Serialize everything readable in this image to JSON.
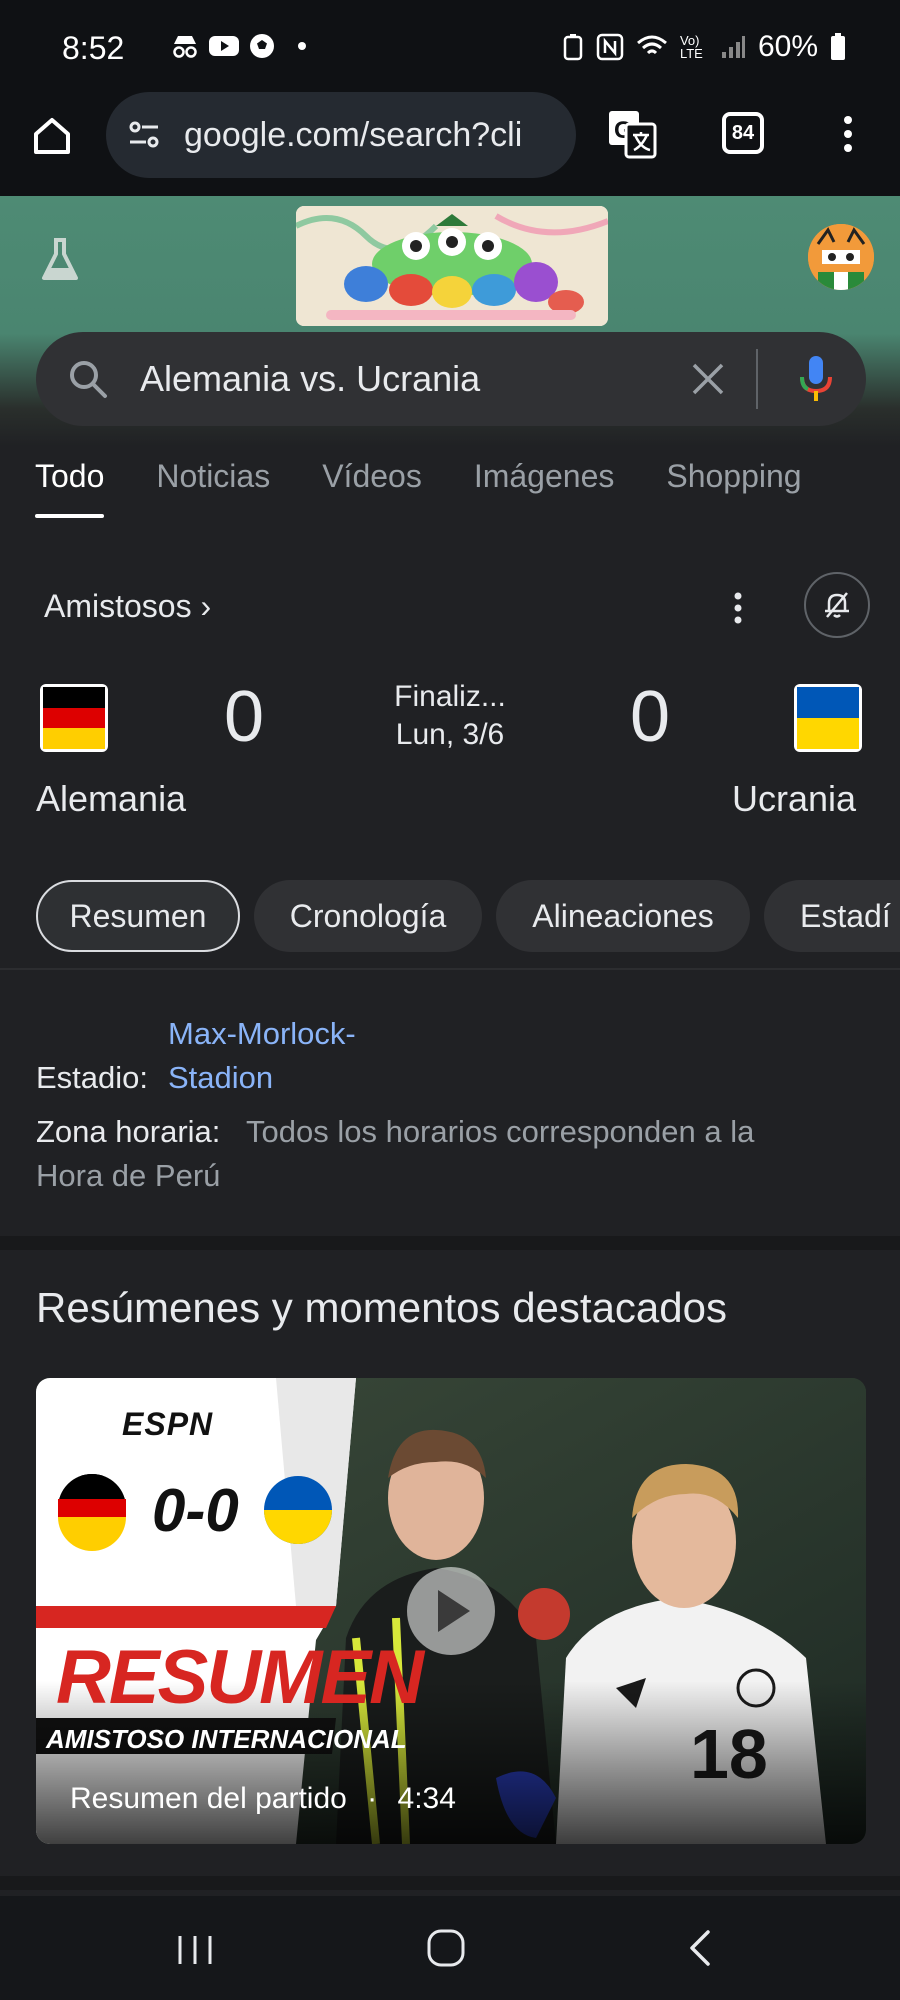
{
  "status_bar": {
    "time": "8:52",
    "battery": "60%",
    "signal_label": "Vo) LTE"
  },
  "browser": {
    "url": "google.com/search?cli",
    "tab_count": "84"
  },
  "search": {
    "query": "Alemania vs. Ucrania"
  },
  "tabs": [
    {
      "label": "Todo"
    },
    {
      "label": "Noticias"
    },
    {
      "label": "Vídeos"
    },
    {
      "label": "Imágenes"
    },
    {
      "label": "Shopping"
    }
  ],
  "match": {
    "competition": "Amistosos ›",
    "home": {
      "name": "Alemania",
      "score": "0"
    },
    "away": {
      "name": "Ucrania",
      "score": "0"
    },
    "status": "Finaliz...",
    "date": "Lun, 3/6"
  },
  "chips": [
    {
      "label": "Resumen"
    },
    {
      "label": "Cronología"
    },
    {
      "label": "Alineaciones"
    },
    {
      "label": "Estadí"
    }
  ],
  "details": {
    "stadium_label": "Estadio:",
    "stadium_line1": "Max-Morlock-",
    "stadium_line2": "Stadion",
    "timezone_label": "Zona horaria:",
    "timezone_value_1": "Todos los horarios corresponden a la",
    "timezone_value_2": "Hora de Perú"
  },
  "highlights": {
    "title": "Resúmenes y momentos destacados",
    "video": {
      "brand": "ESPN",
      "score": "0-0",
      "headline": "RESUMEN",
      "subheadline": "AMISTOSO INTERNACIONAL",
      "caption": "Resumen del partido",
      "separator": "·",
      "duration": "4:34"
    }
  }
}
